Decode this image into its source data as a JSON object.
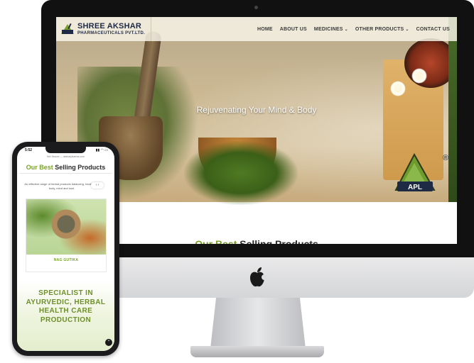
{
  "desktop_site": {
    "logo": {
      "line1": "SHREE AKSHAR",
      "line2": "PHARMACEUTICALS PVT.LTD."
    },
    "nav": [
      {
        "label": "HOME",
        "has_dropdown": false
      },
      {
        "label": "ABOUT US",
        "has_dropdown": false
      },
      {
        "label": "MEDICINES",
        "has_dropdown": true
      },
      {
        "label": "OTHER PRODUCTS",
        "has_dropdown": true
      },
      {
        "label": "CONTACT US",
        "has_dropdown": false
      }
    ],
    "hero_title": "Rejuvenating Your Mind & Body",
    "brand_badge": {
      "text": "APL",
      "registered": "®"
    },
    "section_heading": {
      "accent": "Our Best",
      "rest": "Selling Products"
    }
  },
  "mobile_site": {
    "status_time": "5:52",
    "status_icons": "▮▮ ◠ ▭",
    "url": "Not Secure — aksharpharma.com",
    "section_heading": {
      "accent": "Our Best",
      "rest": "Selling Products"
    },
    "description": "An effective range of herbal products balancing, healing the body, mind and soul.",
    "carousel_arrows": "‹ ›",
    "product_name": "NAG GUTIKA",
    "specialist_text": "SPECIALIST IN AYURVEDIC, HERBAL HEALTH CARE PRODUCTION",
    "scroll_top_icon": "⌃"
  },
  "colors": {
    "accent_green": "#7aa02d",
    "logo_navy": "#1f2a44"
  }
}
